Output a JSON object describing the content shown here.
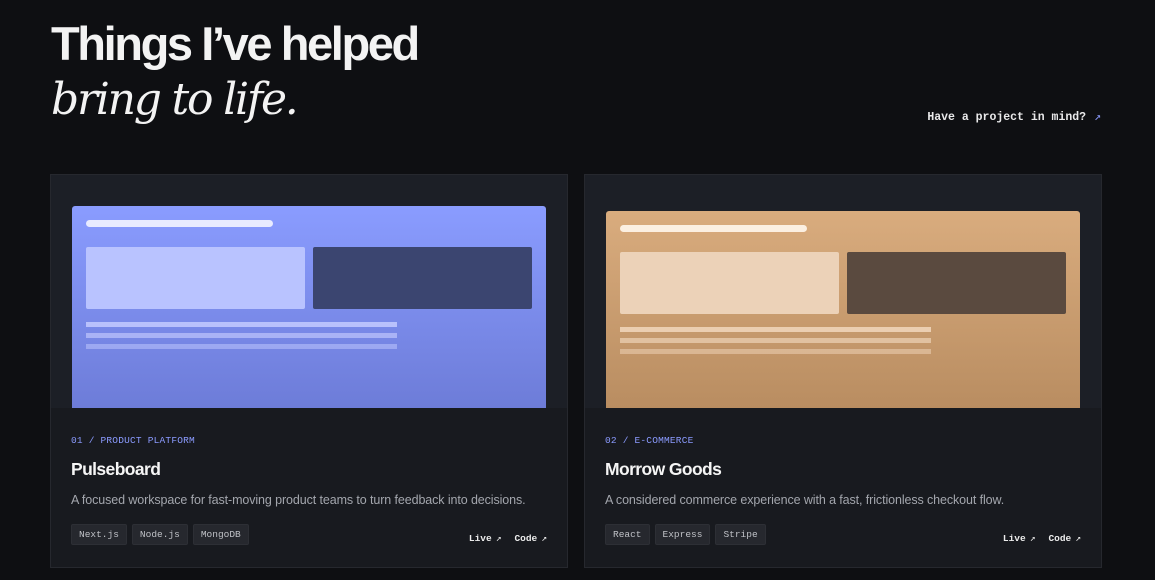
{
  "hero": {
    "title_line1": "Things I’ve helped",
    "title_line2": "bring to life."
  },
  "cta": {
    "label": "Have a project in mind?",
    "arrow": "↗"
  },
  "projects": [
    {
      "meta": "01 / PRODUCT PLATFORM",
      "title": "Pulseboard",
      "description": "A focused workspace for fast-moving product teams to turn feedback into decisions.",
      "tags": [
        "Next.js",
        "Node.js",
        "MongoDB"
      ],
      "live_label": "Live",
      "code_label": "Code",
      "link_arrow": "↗",
      "preview_color": "#8a9cff"
    },
    {
      "meta": "02 / E-COMMERCE",
      "title": "Morrow Goods",
      "description": "A considered commerce experience with a fast, frictionless checkout flow.",
      "tags": [
        "React",
        "Express",
        "Stripe"
      ],
      "live_label": "Live",
      "code_label": "Code",
      "link_arrow": "↗",
      "preview_color": "#d9ac7e"
    }
  ],
  "colors": {
    "accent": "#8b9bff",
    "background": "#0e0f12",
    "card": "#181a1f"
  }
}
